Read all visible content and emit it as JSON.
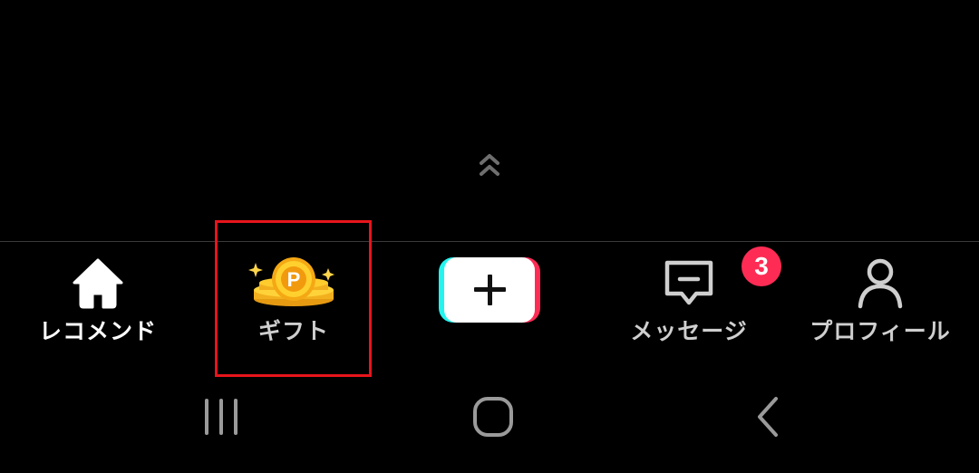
{
  "nav": {
    "items": [
      {
        "label": "レコメンド",
        "icon": "home-icon",
        "active": true
      },
      {
        "label": "ギフト",
        "icon": "gift-coin-icon",
        "active": false
      },
      {
        "label": "",
        "icon": "create-plus-icon",
        "active": false
      },
      {
        "label": "メッセージ",
        "icon": "message-icon",
        "badge": "3",
        "active": false
      },
      {
        "label": "プロフィール",
        "icon": "profile-icon",
        "active": false
      }
    ]
  },
  "coin_letter": "P",
  "swipe_hint_icon": "double-chevron-up-icon",
  "system_nav": {
    "recents_icon": "recents-icon",
    "home_icon": "system-home-icon",
    "back_icon": "back-icon"
  },
  "colors": {
    "background": "#000000",
    "badge": "#fe2c55",
    "highlight_border": "#e8141c",
    "create_cyan": "#25f4ee",
    "create_pink": "#fe2c55"
  }
}
